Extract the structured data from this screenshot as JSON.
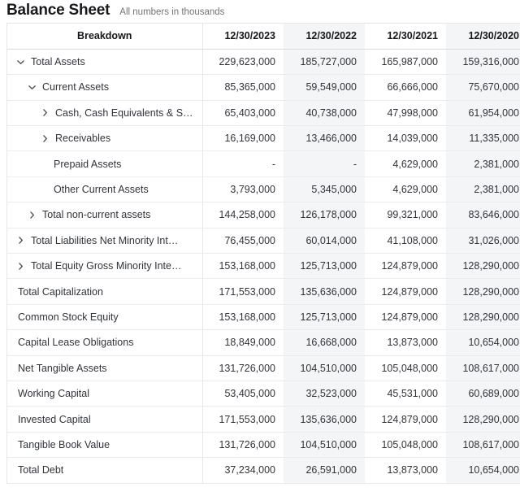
{
  "header": {
    "title": "Balance Sheet",
    "subtitle": "All numbers in thousands"
  },
  "table": {
    "columns": [
      {
        "key": "breakdown",
        "label": "Breakdown",
        "tint": false
      },
      {
        "key": "2023",
        "label": "12/30/2023",
        "tint": false
      },
      {
        "key": "2022",
        "label": "12/30/2022",
        "tint": true
      },
      {
        "key": "2021",
        "label": "12/30/2021",
        "tint": false
      },
      {
        "key": "2020",
        "label": "12/30/2020",
        "tint": true
      }
    ],
    "rows": [
      {
        "label": "Total Assets",
        "indent": 0,
        "toggle": "expanded",
        "values": [
          "229,623,000",
          "185,727,000",
          "165,987,000",
          "159,316,000"
        ]
      },
      {
        "label": "Current Assets",
        "indent": 1,
        "toggle": "expanded",
        "values": [
          "85,365,000",
          "59,549,000",
          "66,666,000",
          "75,670,000"
        ]
      },
      {
        "label": "Cash, Cash Equivalents & S…",
        "indent": 2,
        "toggle": "collapsed",
        "values": [
          "65,403,000",
          "40,738,000",
          "47,998,000",
          "61,954,000"
        ]
      },
      {
        "label": "Receivables",
        "indent": 2,
        "toggle": "collapsed",
        "values": [
          "16,169,000",
          "13,466,000",
          "14,039,000",
          "11,335,000"
        ]
      },
      {
        "label": "Prepaid Assets",
        "indent": 2,
        "toggle": "none",
        "values": [
          "-",
          "-",
          "4,629,000",
          "2,381,000"
        ]
      },
      {
        "label": "Other Current Assets",
        "indent": 2,
        "toggle": "none",
        "values": [
          "3,793,000",
          "5,345,000",
          "4,629,000",
          "2,381,000"
        ]
      },
      {
        "label": "Total non-current assets",
        "indent": 1,
        "toggle": "collapsed",
        "values": [
          "144,258,000",
          "126,178,000",
          "99,321,000",
          "83,646,000"
        ]
      },
      {
        "label": "Total Liabilities Net Minority Int…",
        "indent": 0,
        "toggle": "collapsed",
        "values": [
          "76,455,000",
          "60,014,000",
          "41,108,000",
          "31,026,000"
        ]
      },
      {
        "label": "Total Equity Gross Minority Inte…",
        "indent": 0,
        "toggle": "collapsed",
        "values": [
          "153,168,000",
          "125,713,000",
          "124,879,000",
          "128,290,000"
        ]
      },
      {
        "label": "Total Capitalization",
        "indent": 0,
        "toggle": "none",
        "values": [
          "171,553,000",
          "135,636,000",
          "124,879,000",
          "128,290,000"
        ]
      },
      {
        "label": "Common Stock Equity",
        "indent": 0,
        "toggle": "none",
        "values": [
          "153,168,000",
          "125,713,000",
          "124,879,000",
          "128,290,000"
        ]
      },
      {
        "label": "Capital Lease Obligations",
        "indent": 0,
        "toggle": "none",
        "values": [
          "18,849,000",
          "16,668,000",
          "13,873,000",
          "10,654,000"
        ]
      },
      {
        "label": "Net Tangible Assets",
        "indent": 0,
        "toggle": "none",
        "values": [
          "131,726,000",
          "104,510,000",
          "105,048,000",
          "108,617,000"
        ]
      },
      {
        "label": "Working Capital",
        "indent": 0,
        "toggle": "none",
        "values": [
          "53,405,000",
          "32,523,000",
          "45,531,000",
          "60,689,000"
        ]
      },
      {
        "label": "Invested Capital",
        "indent": 0,
        "toggle": "none",
        "values": [
          "171,553,000",
          "135,636,000",
          "124,879,000",
          "128,290,000"
        ]
      },
      {
        "label": "Tangible Book Value",
        "indent": 0,
        "toggle": "none",
        "values": [
          "131,726,000",
          "104,510,000",
          "105,048,000",
          "108,617,000"
        ]
      },
      {
        "label": "Total Debt",
        "indent": 0,
        "toggle": "none",
        "values": [
          "37,234,000",
          "26,591,000",
          "13,873,000",
          "10,654,000"
        ]
      }
    ]
  },
  "colors": {
    "tint": "#f3f5f7",
    "border": "#e9ecee",
    "text": "#30343a",
    "heading": "#17181c",
    "subtitle": "#6f7479"
  }
}
